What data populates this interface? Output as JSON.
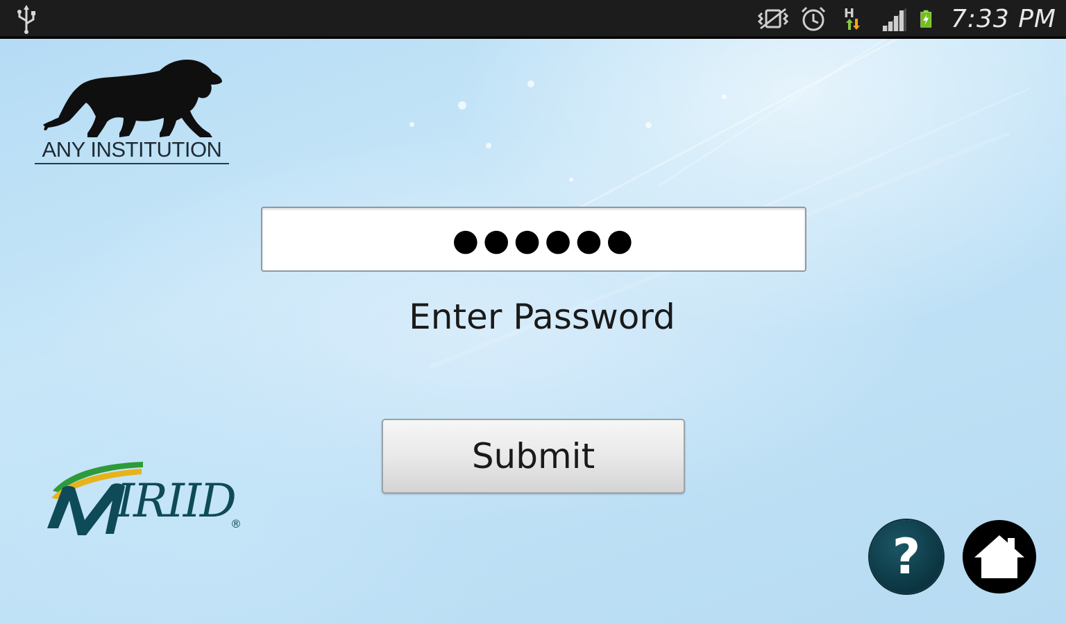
{
  "status_bar": {
    "time": "7:33 PM",
    "icons": [
      "usb-icon",
      "vibrate-icon",
      "alarm-icon",
      "hspa-data-icon",
      "signal-icon",
      "battery-charging-icon"
    ]
  },
  "institution": {
    "name": "ANY INSTITUTION",
    "logo": "lion-icon"
  },
  "password": {
    "value": "●●●●●●",
    "label": "Enter Password"
  },
  "submit": {
    "label": "Submit"
  },
  "brand": {
    "text": "MiriID",
    "registered": "®"
  },
  "help_button": {
    "glyph": "?"
  },
  "home_button": {
    "icon": "home-icon"
  },
  "colors": {
    "status_bar": "#1c1c1c",
    "background": "#bfe1f6",
    "brand_teal": "#0e4a57",
    "brand_green": "#2e9b3a",
    "brand_yellow": "#e8b21a"
  }
}
